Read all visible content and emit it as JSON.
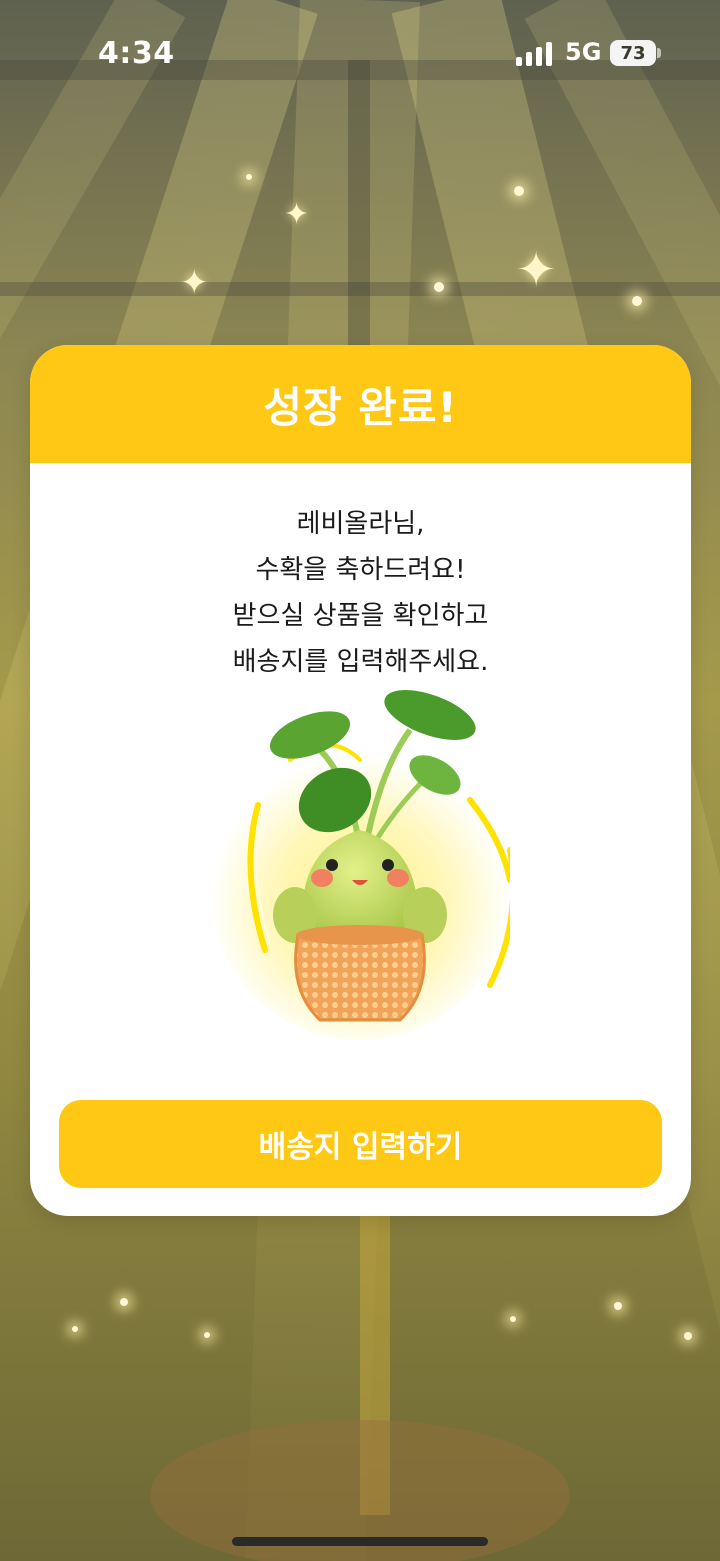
{
  "status_bar": {
    "time": "4:34",
    "network": "5G",
    "battery": "73"
  },
  "modal": {
    "title": "성장 완료!",
    "message_lines": [
      "레비올라님,",
      "수확을 축하드려요!",
      "받으실 상품을 확인하고",
      "배송지를 입력해주세요."
    ],
    "illustration": "plant-character-in-basket",
    "cta_label": "배송지 입력하기"
  },
  "colors": {
    "accent": "#ffc814",
    "text": "#1b1b1b",
    "card": "#ffffff"
  }
}
